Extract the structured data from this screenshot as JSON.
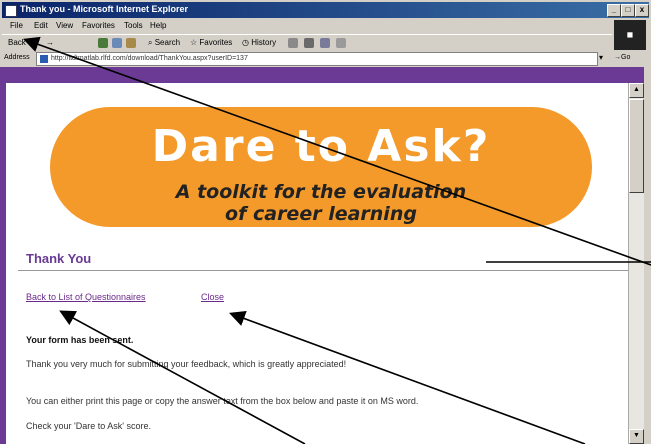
{
  "window": {
    "title": "Thank you - Microsoft Internet Explorer",
    "controls": [
      "_",
      "□",
      "x"
    ]
  },
  "menu": [
    "File",
    "Edit",
    "View",
    "Favorites",
    "Tools",
    "Help"
  ],
  "toolbar": {
    "back": "Back",
    "search": "Search",
    "favorites": "Favorites",
    "history": "History"
  },
  "address": {
    "label": "Address",
    "url": "http://ltdtmatlab.rlfd.com/download/ThankYou.aspx?userID=137",
    "go": "Go"
  },
  "banner": {
    "title": "Dare to Ask?",
    "subtitle_line1": "A toolkit for the evaluation",
    "subtitle_line2": "of career learning"
  },
  "page": {
    "heading": "Thank You",
    "links": {
      "back_to_list": "Back to List of Questionnaires",
      "close": "Close"
    },
    "sent_msg": "Your form has been sent.",
    "para1": "Thank you very much for submitting your feedback, which is greatly appreciated!",
    "para2": "You can either print this page or copy the answer text from the box below and paste it on MS word.",
    "para3": "Check your 'Dare to Ask' score."
  },
  "colors": {
    "accent": "#6a3a94",
    "banner": "#f39a2b",
    "link": "#6a2a8a"
  }
}
